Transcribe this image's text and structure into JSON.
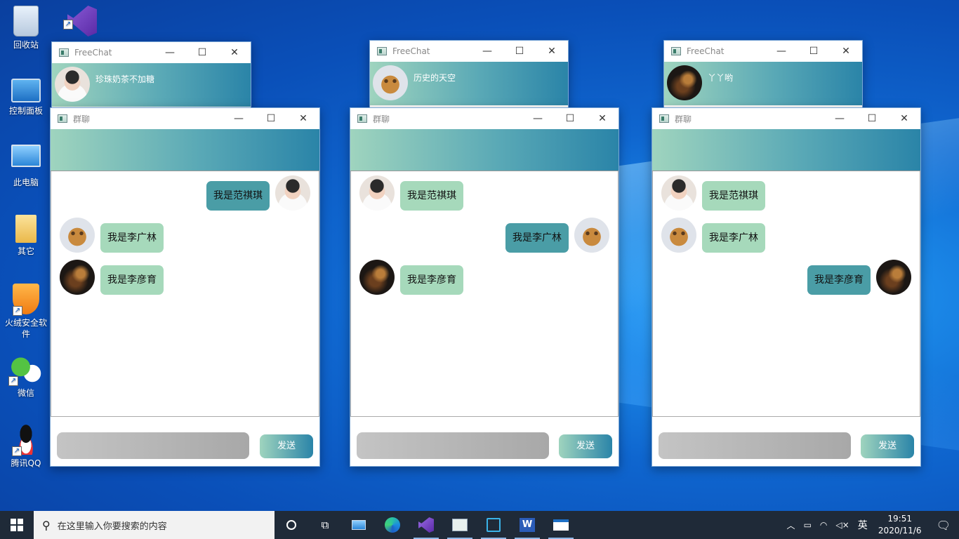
{
  "desktop": {
    "icons": [
      {
        "label": "回收站",
        "icon": "recycle-bin-icon"
      },
      {
        "label": "控制面板",
        "icon": "control-panel-icon"
      },
      {
        "label": "此电脑",
        "icon": "computer-icon"
      },
      {
        "label": "其它",
        "icon": "folder-icon"
      },
      {
        "label": "火绒安全软件",
        "icon": "huorong-icon"
      },
      {
        "label": "微信",
        "icon": "wechat-icon"
      },
      {
        "label": "腾讯QQ",
        "icon": "qq-icon"
      }
    ]
  },
  "friend_windows": [
    {
      "title": "FreeChat",
      "username": "珍珠奶茶不加糖"
    },
    {
      "title": "FreeChat",
      "username": "历史的天空"
    },
    {
      "title": "FreeChat",
      "username": "丫丫哟"
    }
  ],
  "group_windows": [
    {
      "title": "群聊",
      "messages": [
        {
          "text": "我是范祺琪",
          "self": true
        },
        {
          "text": "我是李广林",
          "self": false
        },
        {
          "text": "我是李彦育",
          "self": false
        }
      ],
      "input_value": "",
      "send_label": "发送"
    },
    {
      "title": "群聊",
      "messages": [
        {
          "text": "我是范祺琪",
          "self": false
        },
        {
          "text": "我是李广林",
          "self": true
        },
        {
          "text": "我是李彦育",
          "self": false
        }
      ],
      "input_value": "",
      "send_label": "发送"
    },
    {
      "title": "群聊",
      "messages": [
        {
          "text": "我是范祺琪",
          "self": false
        },
        {
          "text": "我是李广林",
          "self": false
        },
        {
          "text": "我是李彦育",
          "self": true
        }
      ],
      "input_value": "",
      "send_label": "发送"
    }
  ],
  "taskbar": {
    "search_placeholder": "在这里输入你要搜索的内容",
    "ime": "英",
    "time": "19:51",
    "date": "2020/11/6"
  },
  "colors": {
    "bubble_other": "#a6d9bb",
    "bubble_self": "#4a9da6",
    "gradient_start": "#9fd4be",
    "gradient_end": "#2a84a8"
  }
}
